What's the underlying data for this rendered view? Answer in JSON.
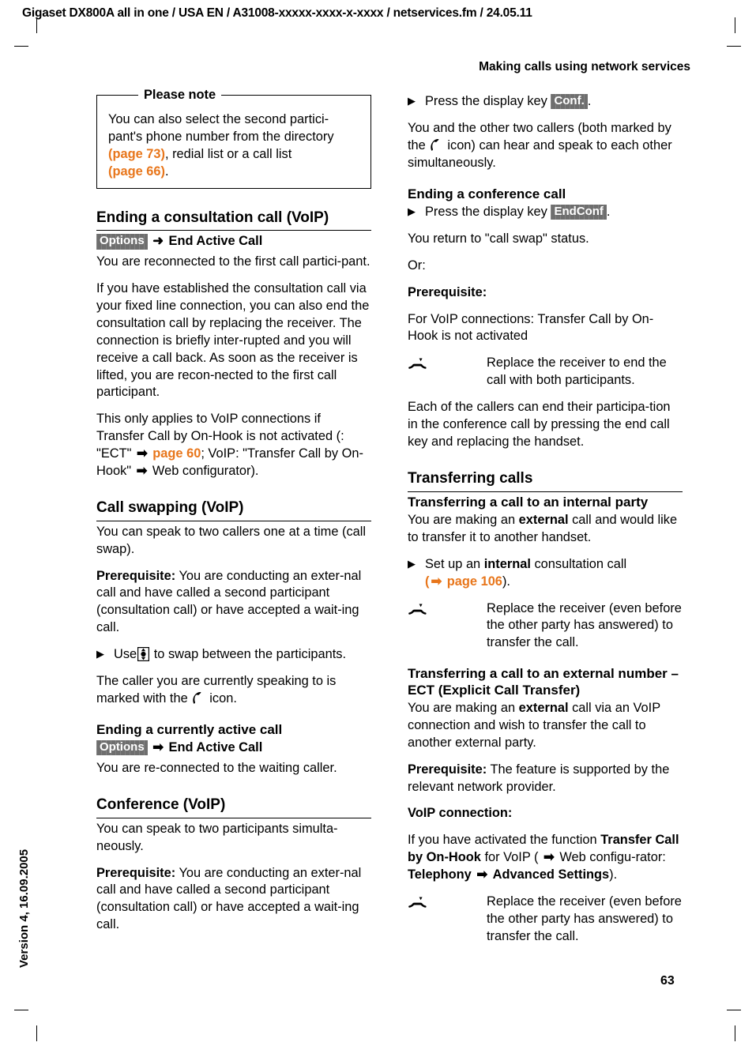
{
  "doc": {
    "running_header": "Gigaset DX800A all in one / USA EN / A31008-xxxxx-xxxx-x-xxxx / netservices.fm / 24.05.11",
    "chapter_header": "Making calls using network services",
    "version_line": "Version 4, 16.09.2005",
    "page_number": "63"
  },
  "colors": {
    "accent_orange": "#E8761B",
    "display_key_bg": "#6e6e6e",
    "text": "#000000"
  },
  "note": {
    "title": "Please note",
    "text_1": "You can also select the second partici-pant's phone number from the directory ",
    "ref_1": "(page 73)",
    "text_2": ", redial list or a call list",
    "ref_2": "(page 66)",
    "text_3": "."
  },
  "left_column": {
    "s1": {
      "heading": "Ending a consultation call (VoIP)",
      "key": "Options",
      "arrow": "➜",
      "key_action": "End Active Call",
      "p1": "You are reconnected to the first call partici-pant.",
      "p2": "If you have established the consultation call via your fixed line connection, you can also end the consultation call by replacing the receiver. The connection is briefly inter-rupted and you will receive a call back. As soon as the receiver is lifted, you are recon-nected to the first call participant.",
      "p3_a": "This only applies to VoIP connections if Transfer Call by On-Hook is not activated (: \"ECT\" ",
      "p3_ref": "page 60",
      "p3_b": "; VoIP: \"Transfer Call by On-Hook\" ",
      "p3_c": " Web configurator)."
    },
    "s2": {
      "heading": "Call swapping (VoIP)",
      "p1": "You can speak to two callers one at a time (call swap).",
      "prereq_label": "Prerequisite:",
      "prereq_text": " You are conducting an exter-nal call and have called a second participant (consultation call) or have accepted a wait-ing call.",
      "step_a": "Use",
      "step_b": "to swap between the participants.",
      "p2_a": "The caller you are currently speaking to is marked with the",
      "p2_b": "icon."
    },
    "s3": {
      "heading": "Ending a currently active call",
      "key": "Options",
      "key_action": "End Active Call",
      "p1": "You are re-connected to the waiting caller."
    },
    "s4": {
      "heading": "Conference (VoIP)",
      "p1": "You can speak to two participants simulta-neously.",
      "prereq_label": "Prerequisite:",
      "prereq_text": " You are conducting an exter-nal call and have called a second participant (consultation call) or have accepted a wait-ing call."
    }
  },
  "right_column": {
    "s1": {
      "step_a": "Press the display key",
      "step_key": "Conf.",
      "step_b": ".",
      "p1_a": "You and the other two callers (both marked by the",
      "p1_b": "icon) can hear and speak to each other simultaneously."
    },
    "s2": {
      "heading": "Ending a conference call",
      "step_a": "Press the display key",
      "step_key": "EndConf",
      "step_b": ".",
      "p1": "You return to \"call swap\" status.",
      "p2": "Or:",
      "prereq_label": "Prerequisite:",
      "p3": "For VoIP connections: Transfer Call by On-Hook is not activated",
      "key_action": "Replace the receiver to end the call with both participants.",
      "p4": "Each of the callers can end their participa-tion in the conference call by pressing the end call key and replacing the handset."
    },
    "s3": {
      "heading": "Transferring calls",
      "sub1": {
        "heading": "Transferring a call to an internal party",
        "p1_a": "You are making an ",
        "p1_bold": "external",
        "p1_b": " call and would like to transfer it to another handset.",
        "step_a": "Set up an ",
        "step_bold": "internal",
        "step_b": " consultation call",
        "step_ref_open": "(",
        "step_ref": "page 106",
        "step_ref_close": ").",
        "key_action": "Replace the receiver (even before the other party has answered) to transfer the call."
      },
      "sub2": {
        "heading": "Transferring a call to an external number – ECT (Explicit Call Transfer)",
        "p1_a": "You are making an ",
        "p1_bold": "external",
        "p1_b": " call via an VoIP connection and wish to transfer the call to another external party.",
        "prereq_label": "Prerequisite:",
        "prereq_text": " The feature is supported by the relevant network provider.",
        "voip_label": "VoIP connection:",
        "p2_a": "If you have activated the function ",
        "p2_bold1": "Transfer Call by On-Hook",
        "p2_b": " for VoIP ( ",
        "p2_c": " Web configu-rator: ",
        "p2_bold2": "Telephony",
        "p2_d": " ",
        "p2_bold3": "Advanced Settings",
        "p2_e": ").",
        "key_action": "Replace the receiver (even before the other party has answered) to transfer the call."
      }
    }
  },
  "icons": {
    "handset_offhook": "handset-offhook-icon",
    "handset_onhook": "handset-onhook-icon",
    "control_key": "control-key-icon",
    "arrow_right": "arrow-right-icon",
    "step_triangle": "step-triangle-icon"
  }
}
